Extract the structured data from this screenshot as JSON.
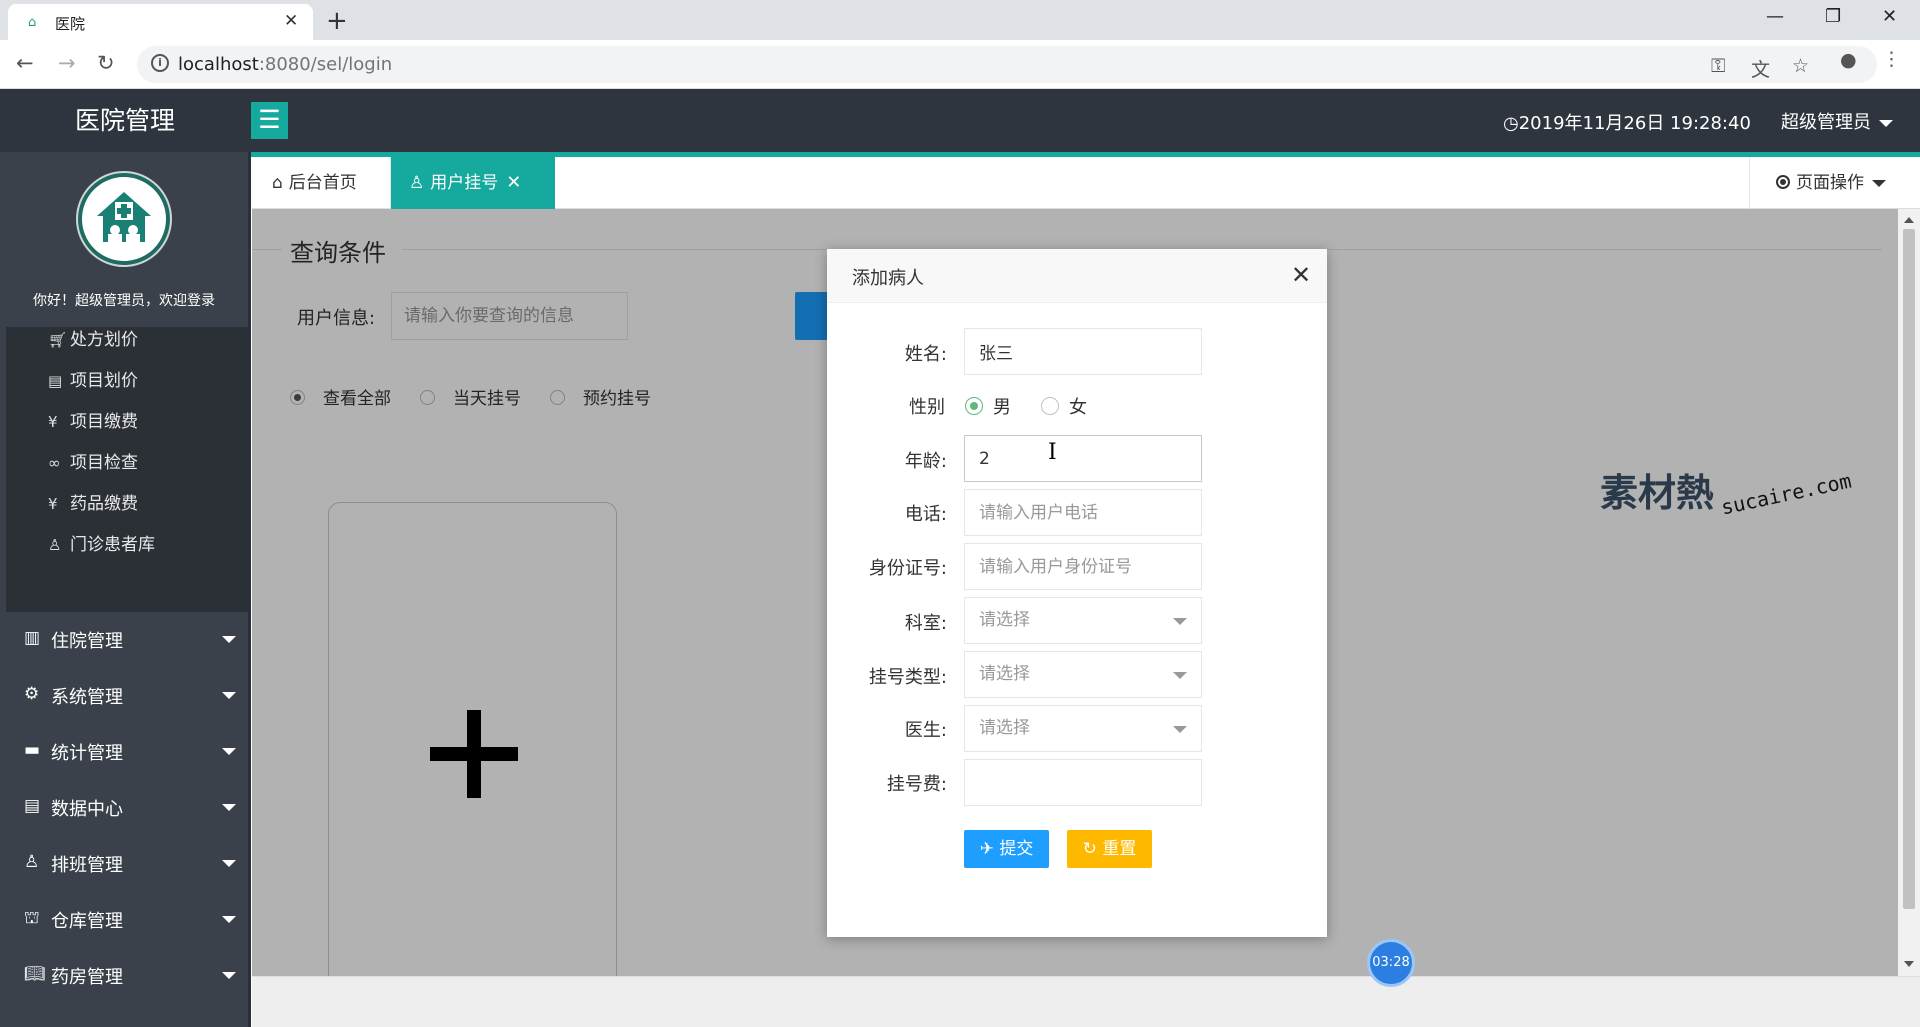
{
  "browser": {
    "tab_title": "医院",
    "tab_close": "✕",
    "new_tab": "+",
    "url_host": "localhost",
    "url_rest": ":8080/sel/login",
    "info_icon": "i"
  },
  "header": {
    "brand": "医院管理",
    "datetime": "2019年11月26日 19:28:40",
    "user": "超级管理员"
  },
  "sidebar": {
    "welcome": "你好！超级管理员，欢迎登录",
    "sub_items": [
      {
        "label": "处方划价",
        "icon": "cart-icon"
      },
      {
        "label": "项目划价",
        "icon": "document-icon"
      },
      {
        "label": "项目缴费",
        "icon": "yen-icon"
      },
      {
        "label": "项目检查",
        "icon": "link-icon"
      },
      {
        "label": "药品缴费",
        "icon": "yen-icon"
      },
      {
        "label": "门诊患者库",
        "icon": "user-icon"
      }
    ],
    "sections": [
      {
        "label": "住院管理",
        "icon": "building-icon"
      },
      {
        "label": "系统管理",
        "icon": "gear-icon"
      },
      {
        "label": "统计管理",
        "icon": "chart-icon"
      },
      {
        "label": "数据中心",
        "icon": "document-icon"
      },
      {
        "label": "排班管理",
        "icon": "user-icon"
      },
      {
        "label": "仓库管理",
        "icon": "warehouse-icon"
      },
      {
        "label": "药房管理",
        "icon": "book-icon"
      }
    ]
  },
  "tabs": {
    "home": "后台首页",
    "active": "用户挂号",
    "close": "✕",
    "page_ops": "页面操作"
  },
  "query": {
    "title": "查询条件",
    "label": "用户信息:",
    "placeholder": "请输入你要查询的信息",
    "filters": [
      "查看全部",
      "当天挂号",
      "预约挂号"
    ],
    "selected_filter": "查看全部"
  },
  "modal": {
    "title": "添加病人",
    "close": "✕",
    "fields": {
      "name_label": "姓名:",
      "name_value": "张三",
      "sex_label": "性别",
      "sex_male": "男",
      "sex_female": "女",
      "sex_selected": "男",
      "age_label": "年龄:",
      "age_value": "2",
      "phone_label": "电话:",
      "phone_placeholder": "请输入用户电话",
      "idcard_label": "身份证号:",
      "idcard_placeholder": "请输入用户身份证号",
      "dept_label": "科室:",
      "dept_placeholder": "请选择",
      "regtype_label": "挂号类型:",
      "regtype_placeholder": "请选择",
      "doctor_label": "医生:",
      "doctor_placeholder": "请选择",
      "fee_label": "挂号费:",
      "fee_value": ""
    },
    "submit": "提交",
    "reset": "重置"
  },
  "watermark": {
    "cn": "素材熱",
    "en": "sucaire.com"
  },
  "recording_time": "03:28",
  "colors": {
    "teal": "#16a99d",
    "sidebar": "#3a414a",
    "header": "#2e353e",
    "primary": "#1e9fff",
    "warning": "#ffb800",
    "radio_on": "#5fb878"
  }
}
